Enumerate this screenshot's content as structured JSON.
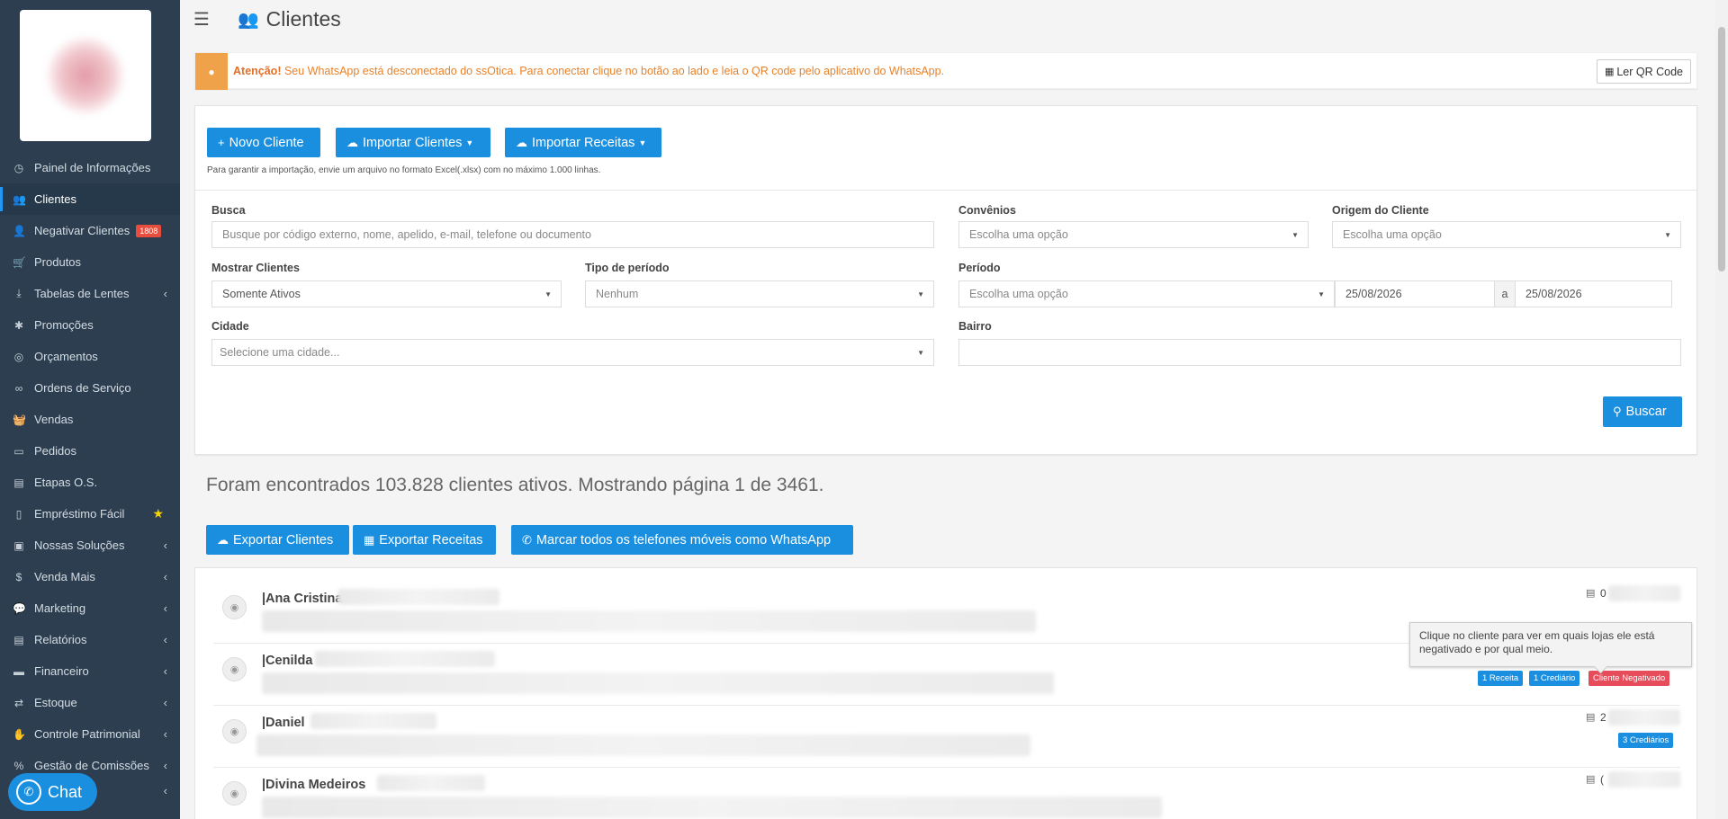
{
  "header": {
    "title": "Clientes"
  },
  "sidebar": {
    "items": [
      {
        "label": "Painel de Informações",
        "icon": "dashboard-icon",
        "glyph": "◷"
      },
      {
        "label": "Clientes",
        "icon": "users-icon",
        "glyph": "👥"
      },
      {
        "label": "Negativar Clientes",
        "icon": "user-x-icon",
        "glyph": "👤",
        "badge": "1808"
      },
      {
        "label": "Produtos",
        "icon": "cart-icon",
        "glyph": "🛒"
      },
      {
        "label": "Tabelas de Lentes",
        "icon": "download-icon",
        "glyph": "⤓"
      },
      {
        "label": "Promoções",
        "icon": "asterisk-icon",
        "glyph": "✱"
      },
      {
        "label": "Orçamentos",
        "icon": "support-icon",
        "glyph": "◎"
      },
      {
        "label": "Ordens de Serviço",
        "icon": "glasses-icon",
        "glyph": "∞"
      },
      {
        "label": "Vendas",
        "icon": "basket-icon",
        "glyph": "🧺"
      },
      {
        "label": "Pedidos",
        "icon": "inbox-icon",
        "glyph": "▭"
      },
      {
        "label": "Etapas O.S.",
        "icon": "list-icon",
        "glyph": "▤"
      },
      {
        "label": "Empréstimo Fácil",
        "icon": "receipt-icon",
        "glyph": "▯"
      },
      {
        "label": "Nossas Soluções",
        "icon": "briefcase-icon",
        "glyph": "▣"
      },
      {
        "label": "Venda Mais",
        "icon": "dollar-icon",
        "glyph": "$"
      },
      {
        "label": "Marketing",
        "icon": "comments-icon",
        "glyph": "💬"
      },
      {
        "label": "Relatórios",
        "icon": "report-icon",
        "glyph": "▤"
      },
      {
        "label": "Financeiro",
        "icon": "money-icon",
        "glyph": "▬"
      },
      {
        "label": "Estoque",
        "icon": "exchange-icon",
        "glyph": "⇄"
      },
      {
        "label": "Controle Patrimonial",
        "icon": "hand-icon",
        "glyph": "✋"
      },
      {
        "label": "Gestão de Comissões",
        "icon": "percent-icon",
        "glyph": "%"
      }
    ],
    "chat_label": "Chat"
  },
  "alert": {
    "strong": "Atenção!",
    "text": " Seu WhatsApp está desconectado do ssOtica. Para conectar clique no botão ao lado e leia o QR code pelo aplicativo do WhatsApp.",
    "qr_button": "Ler QR Code"
  },
  "toolbar": {
    "new_client": "Novo Cliente",
    "import_clients": "Importar Clientes",
    "import_recipes": "Importar Receitas",
    "hint": "Para garantir a importação, envie um arquivo no formato Excel(.xlsx) com no máximo 1.000 linhas."
  },
  "filters": {
    "busca_label": "Busca",
    "busca_placeholder": "Busque por código externo, nome, apelido, e-mail, telefone ou documento",
    "convenios_label": "Convênios",
    "convenios_value": "Escolha uma opção",
    "origem_label": "Origem do Cliente",
    "origem_value": "Escolha uma opção",
    "mostrar_label": "Mostrar Clientes",
    "mostrar_value": "Somente Ativos",
    "tipo_label": "Tipo de período",
    "tipo_value": "Nenhum",
    "periodo_label": "Período",
    "periodo_value": "Escolha uma opção",
    "date_from": "25/08/2026",
    "date_sep": "a",
    "date_to": "25/08/2026",
    "cidade_label": "Cidade",
    "cidade_value": "Selecione uma cidade...",
    "bairro_label": "Bairro",
    "search_button": "Buscar"
  },
  "summary": "Foram encontrados 103.828 clientes ativos. Mostrando página 1 de 3461.",
  "actions": {
    "export_clients": "Exportar Clientes",
    "export_recipes": "Exportar Receitas",
    "mark_whatsapp": "Marcar todos os telefones móveis como WhatsApp"
  },
  "clients": [
    {
      "name": "|Ana Cristina",
      "id_partial": "0"
    },
    {
      "name": "|Cenilda",
      "id_partial": "",
      "tags": [
        "1 Receita",
        "1 Crediário",
        "Cliente Negativado"
      ]
    },
    {
      "name": "|Daniel",
      "id_partial": "2",
      "tags": [
        "3 Crediários"
      ]
    },
    {
      "name": "|Divina Medeiros",
      "id_partial": "("
    }
  ],
  "tooltip": "Clique no cliente para ver em quais lojas ele está negativado e por qual meio.",
  "colors": {
    "primary": "#1a8fe0",
    "sidebar": "#2c3e50",
    "warning": "#f0a24a",
    "danger": "#e74c5a"
  }
}
